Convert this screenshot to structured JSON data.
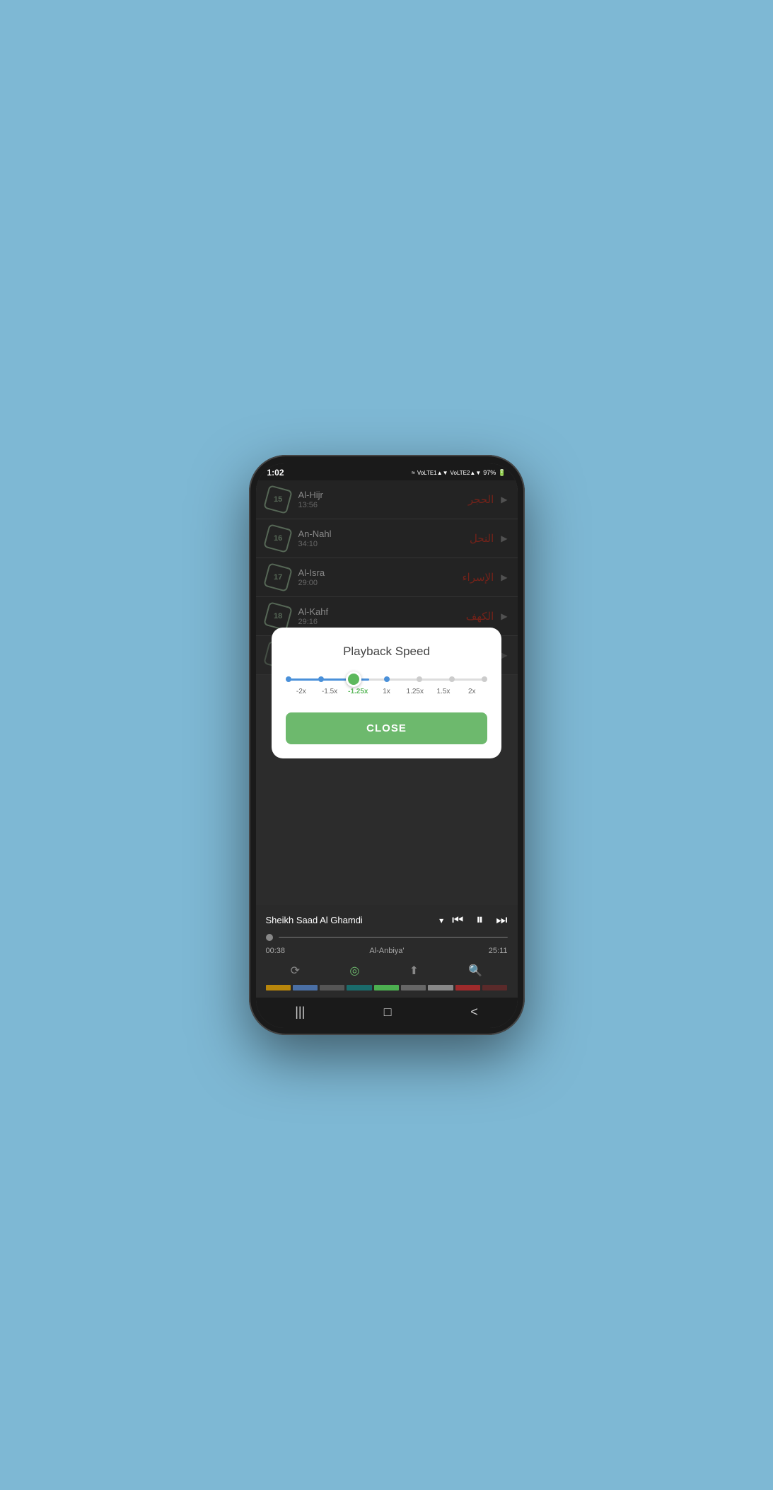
{
  "statusBar": {
    "time": "1:02",
    "batteryPercent": "97%"
  },
  "surahList": [
    {
      "number": "15",
      "name": "Al-Hijr",
      "duration": "13:56",
      "arabic": "الحجر"
    },
    {
      "number": "16",
      "name": "An-Nahl",
      "duration": "34:10",
      "arabic": "النحل"
    },
    {
      "number": "17",
      "name": "Al-Isra",
      "duration": "29:00",
      "arabic": "الإسراء"
    },
    {
      "number": "18",
      "name": "Al-Kahf",
      "duration": "29:16",
      "arabic": "الكهف"
    }
  ],
  "dialog": {
    "title": "Playback Speed",
    "speeds": [
      "-2x",
      "-1.5x",
      "-1.25x",
      "1x",
      "1.25x",
      "1.5x",
      "2x"
    ],
    "activeSpeed": "-1.25x",
    "closeLabel": "CLOSE"
  },
  "player": {
    "reciterName": "Sheikh Saad Al Ghamdi",
    "trackName": "Al-Anbiya'",
    "timeElapsed": "00:38",
    "timeTotal": "25:11"
  },
  "swatches": [
    "#b8860b",
    "#4a6fa5",
    "#555",
    "#1a5c5c",
    "#4caf50",
    "#666",
    "#888",
    "#9e2a2b",
    "#5a2a2a"
  ],
  "navBar": {
    "recentsIcon": "|||",
    "homeIcon": "□",
    "backIcon": "<"
  }
}
